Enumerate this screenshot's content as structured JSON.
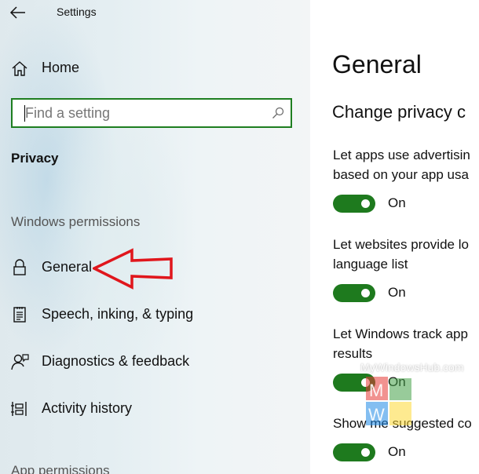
{
  "window": {
    "title": "Settings"
  },
  "sidebar": {
    "home_label": "Home",
    "search_placeholder": "Find a setting",
    "section_title": "Privacy",
    "group_windows_permissions": "Windows permissions",
    "group_app_permissions": "App permissions",
    "items": [
      {
        "label": "General",
        "icon": "lock-icon"
      },
      {
        "label": "Speech, inking, & typing",
        "icon": "speech-notes-icon"
      },
      {
        "label": "Diagnostics & feedback",
        "icon": "diagnostics-person-icon"
      },
      {
        "label": "Activity history",
        "icon": "activity-timeline-icon"
      }
    ]
  },
  "content": {
    "page_title": "General",
    "subtitle": "Change privacy c",
    "settings": [
      {
        "line1": "Let apps use advertisin",
        "line2": "based on your app usa",
        "state": "On"
      },
      {
        "line1": "Let websites provide lo",
        "line2": "language list",
        "state": "On"
      },
      {
        "line1": "Let Windows track app",
        "line2": "results",
        "state": "On"
      },
      {
        "line1": "Show me suggested co",
        "line2": "",
        "state": "On"
      }
    ]
  },
  "watermark": {
    "text": "MyWindowsHub.com"
  },
  "colors": {
    "accent_green": "#1e7a1e",
    "search_border": "#1e7e20",
    "annotation_arrow": "#e0161c"
  }
}
